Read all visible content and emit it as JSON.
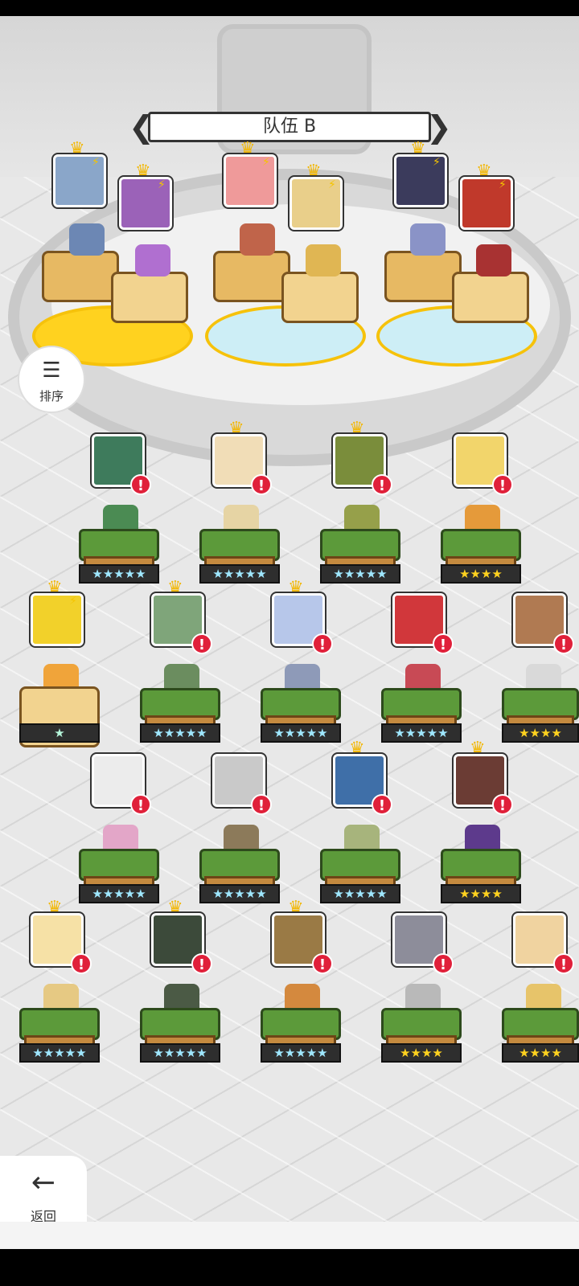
{
  "team": {
    "title": "队伍 B",
    "prev_icon": "chevron-left-icon",
    "next_icon": "chevron-right-icon"
  },
  "sort": {
    "label": "排序",
    "icon": "sort-icon"
  },
  "back": {
    "label": "返回",
    "icon": "arrow-left-icon"
  },
  "glyphs": {
    "crown": "♛",
    "bolt": "⚡",
    "alert": "!",
    "prev": "❮",
    "next": "❯",
    "sort": "☰",
    "back": "←"
  },
  "colors": {
    "gold_star": "#ffd21f",
    "rainbow_star": "#9fe7ff",
    "alert_red": "#e0203a",
    "stage_yellow": "#ffd21f",
    "stage_blue": "#cdeef6"
  },
  "roster_rows": [
    [
      "★★★★★",
      "★★★★★",
      "★★★★★",
      "★★★★"
    ],
    [
      "★",
      "★★★★★",
      "★★★★★",
      "★★★★★",
      "★★★★"
    ],
    [
      "★★★★★",
      "★★★★★",
      "★★★★★",
      "★★★★"
    ],
    [
      "★★★★★",
      "★★★★★",
      "★★★★★",
      "★★★★",
      "★★★★"
    ]
  ]
}
